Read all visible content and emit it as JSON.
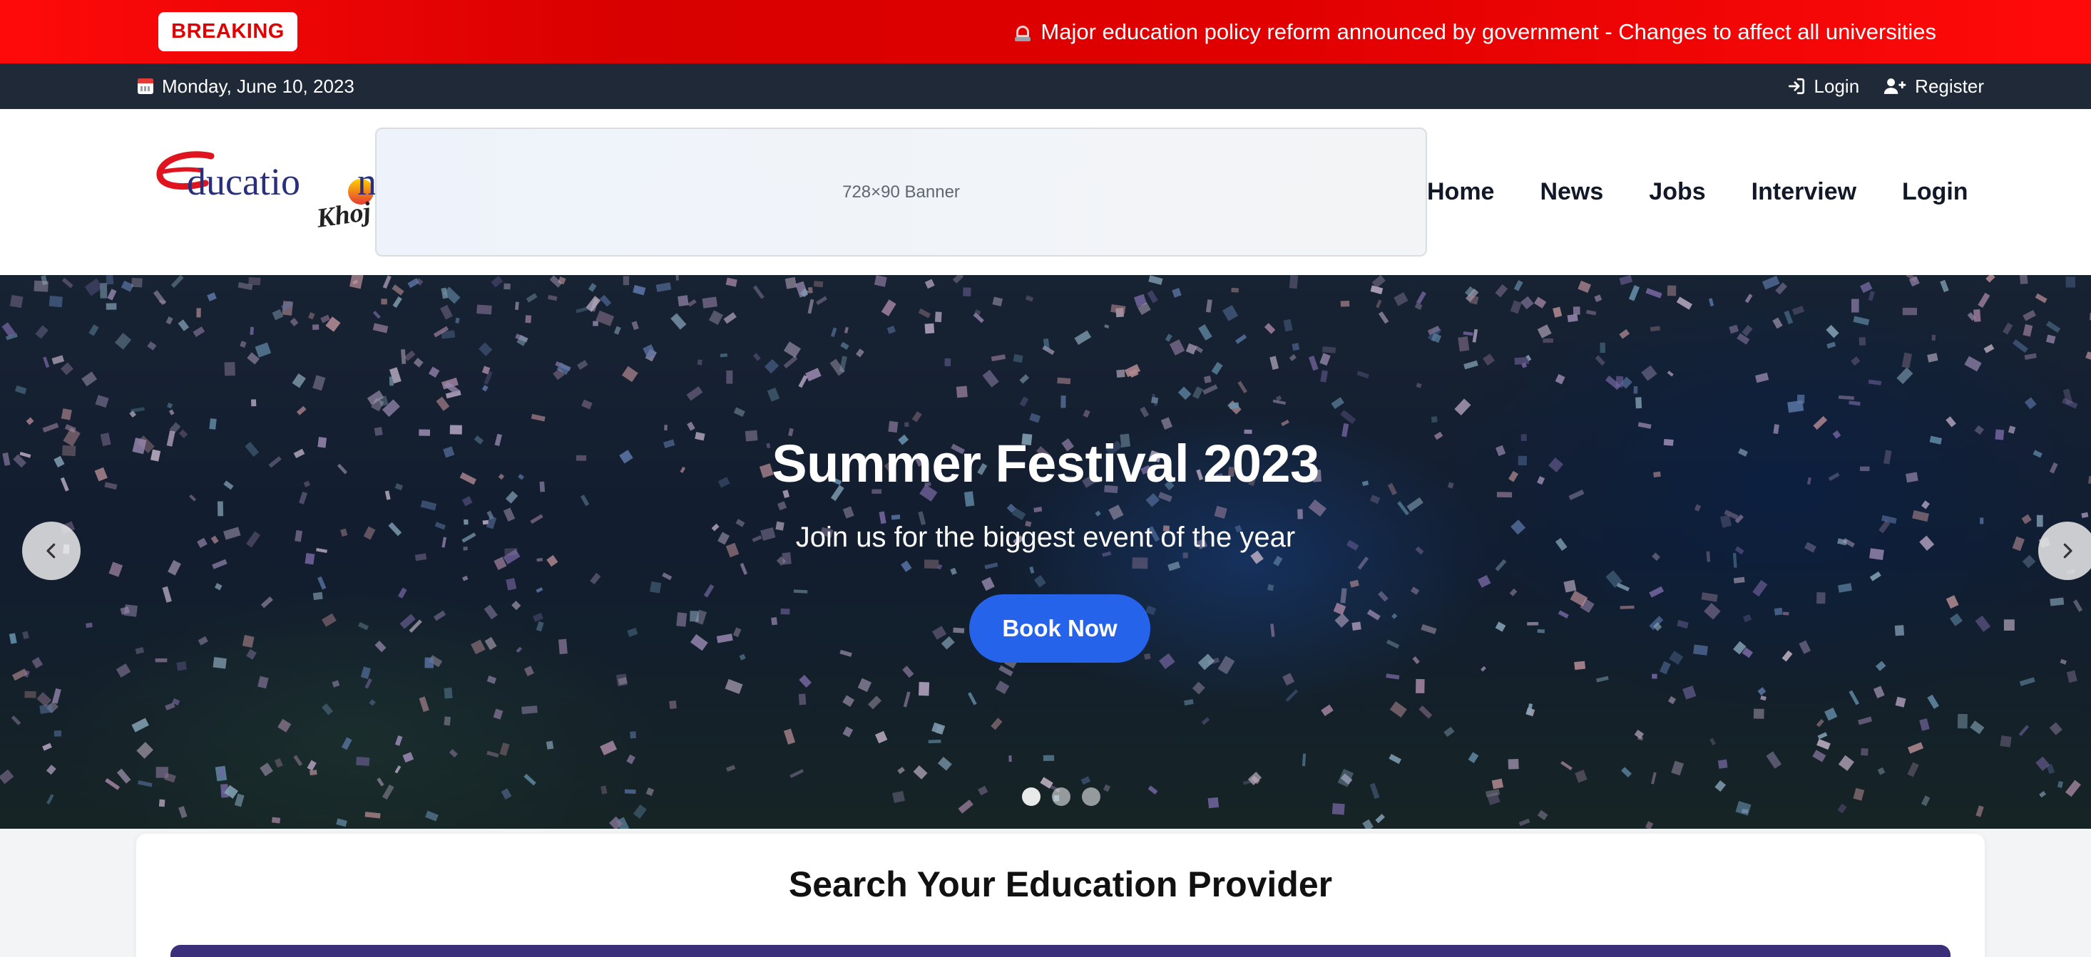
{
  "breaking": {
    "badge": "BREAKING",
    "headline": "Major education policy reform announced by government - Changes to affect all universities",
    "icon": "siren-icon"
  },
  "topbar": {
    "date": "Monday, June 10, 2023",
    "login": "Login",
    "register": "Register"
  },
  "header": {
    "logo_alt": "Education Khoj",
    "banner": "728×90 Banner",
    "nav": [
      "Home",
      "News",
      "Jobs",
      "Interview",
      "Login"
    ]
  },
  "hero": {
    "title": "Summer Festival 2023",
    "subtitle": "Join us for the biggest event of the year",
    "button": "Book Now",
    "slides": 3,
    "active_slide": 1
  },
  "search": {
    "title": "Search Your Education Provider"
  },
  "colors": {
    "breaking_red": "#e00000",
    "topbar": "#1f2937",
    "accent_blue": "#2563eb",
    "search_bar": "#3b2f7a"
  }
}
